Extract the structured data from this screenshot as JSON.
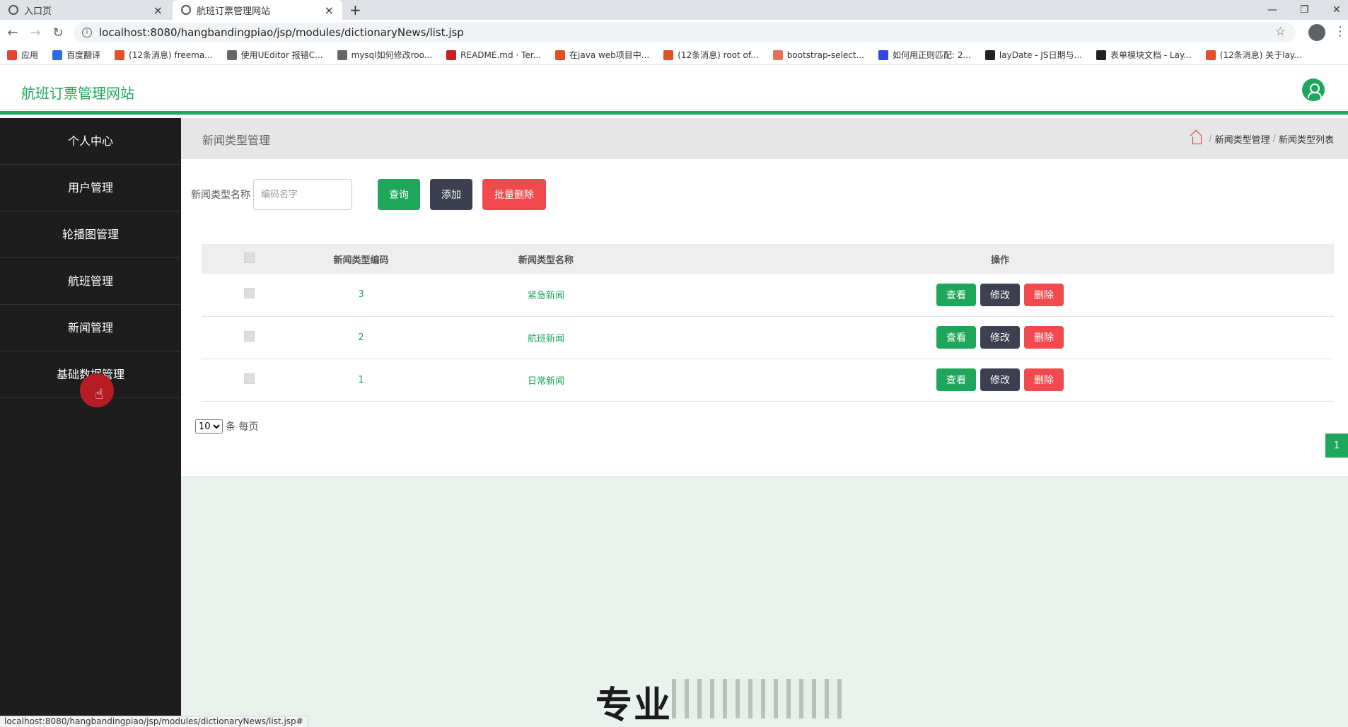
{
  "browser": {
    "tabs": [
      {
        "title": "入口页",
        "active": false
      },
      {
        "title": "航班订票管理网站",
        "active": true
      }
    ],
    "url": "localhost:8080/hangbandingpiao/jsp/modules/dictionaryNews/list.jsp",
    "bookmarks": [
      {
        "label": "应用",
        "icon": "apps-grid-icon",
        "color": "#ea4335"
      },
      {
        "label": "百度翻译",
        "icon": "baidu-translate-icon",
        "color": "#2b6de0"
      },
      {
        "label": "(12条消息) freema...",
        "icon": "csdn-icon",
        "color": "#e34f26"
      },
      {
        "label": "使用UEditor 报错C...",
        "icon": "link-icon",
        "color": "#666666"
      },
      {
        "label": "mysql如何修改roo...",
        "icon": "link-icon",
        "color": "#666666"
      },
      {
        "label": "README.md · Ter...",
        "icon": "gitee-icon",
        "color": "#c71d23"
      },
      {
        "label": "在java web项目中...",
        "icon": "csdn-icon",
        "color": "#e34f26"
      },
      {
        "label": "(12条消息) root of...",
        "icon": "csdn-icon",
        "color": "#e34f26"
      },
      {
        "label": "bootstrap-select...",
        "icon": "jianshu-icon",
        "color": "#ea6f5a"
      },
      {
        "label": "如何用正则匹配: 2...",
        "icon": "baidu-icon",
        "color": "#3245df"
      },
      {
        "label": "layDate - JS日期与...",
        "icon": "layui-icon",
        "color": "#222222"
      },
      {
        "label": "表单模块文档 - Lay...",
        "icon": "layui-icon",
        "color": "#222222"
      },
      {
        "label": "(12条消息) 关于lay...",
        "icon": "csdn-icon",
        "color": "#e34f26"
      }
    ],
    "status_url": "localhost:8080/hangbandingpiao/jsp/modules/dictionaryNews/list.jsp#"
  },
  "app": {
    "title": "航班订票管理网站",
    "accent": "#1ea65a"
  },
  "sidebar": {
    "items": [
      {
        "label": "个人中心"
      },
      {
        "label": "用户管理"
      },
      {
        "label": "轮播图管理"
      },
      {
        "label": "航班管理"
      },
      {
        "label": "新闻管理"
      },
      {
        "label": "基础数据管理"
      }
    ]
  },
  "page": {
    "title": "新闻类型管理",
    "breadcrumb": [
      "新闻类型管理",
      "新闻类型列表"
    ],
    "breadcrumb_sep": "/"
  },
  "search": {
    "label": "新闻类型名称",
    "placeholder": "编码名字",
    "query_label": "查询",
    "add_label": "添加",
    "batch_delete_label": "批量删除"
  },
  "table": {
    "columns": [
      "新闻类型编码",
      "新闻类型名称",
      "操作"
    ],
    "rows": [
      {
        "code": "3",
        "name": "紧急新闻"
      },
      {
        "code": "2",
        "name": "航班新闻"
      },
      {
        "code": "1",
        "name": "日常新闻"
      }
    ],
    "actions": {
      "view": "查看",
      "edit": "修改",
      "delete": "删除"
    }
  },
  "pagination": {
    "page_size": "10",
    "page_size_suffix": "条 每页",
    "current_page": "1"
  },
  "overlay": {
    "watermark_text": "专业"
  }
}
